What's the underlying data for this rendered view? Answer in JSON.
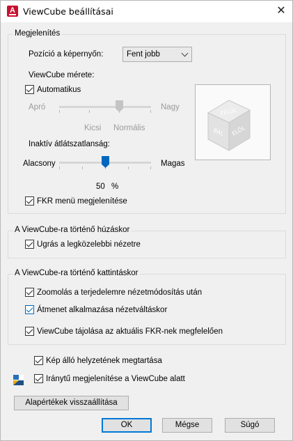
{
  "window": {
    "title": "ViewCube beállításai",
    "close_glyph": "✕",
    "app_icon_letter": "A"
  },
  "display": {
    "group_label": "Megjelenítés",
    "position_label": "Pozíció a képernyőn:",
    "position_value": "Fent jobb",
    "size_label": "ViewCube mérete:",
    "auto_label": "Automatikus",
    "auto_checked": true,
    "size_min_label": "Apró",
    "size_max_label": "Nagy",
    "size_tick_small": "Kicsi",
    "size_tick_normal": "Normális",
    "opacity_label": "Inaktív átlátszatlanság:",
    "opacity_min_label": "Alacsony",
    "opacity_max_label": "Magas",
    "opacity_value": "50",
    "opacity_unit": "%",
    "opacity_fraction": 0.5,
    "ucs_menu_label": "FKR menü megjelenítése",
    "ucs_menu_checked": true
  },
  "cube_faces": {
    "top": "FELÜL",
    "left": "BAL",
    "front": "ELÖL"
  },
  "drag": {
    "group_label": "A ViewCube-ra történő húzáskor",
    "snap_label": "Ugrás a legközelebbi nézetre",
    "snap_checked": true
  },
  "click": {
    "group_label": "A ViewCube-ra történő kattintáskor",
    "zoom_label": "Zoomolás a terjedelemre nézetmódosítás után",
    "zoom_checked": true,
    "transition_label": "Átmenet alkalmazása nézetváltáskor",
    "transition_checked": true,
    "orient_label": "ViewCube tájolása az aktuális FKR-nek megfelelően",
    "orient_checked": true
  },
  "misc": {
    "keep_upright_label": "Kép álló helyzetének megtartása",
    "keep_upright_checked": true,
    "compass_label": "Iránytű megjelenítése a ViewCube alatt",
    "compass_checked": true,
    "compass_icon": "compass-icon"
  },
  "buttons": {
    "restore_defaults": "Alapértékek visszaállítása",
    "ok": "OK",
    "cancel": "Mégse",
    "help": "Súgó"
  },
  "colors": {
    "accent": "#0067c0",
    "brand_red": "#c8102e"
  }
}
